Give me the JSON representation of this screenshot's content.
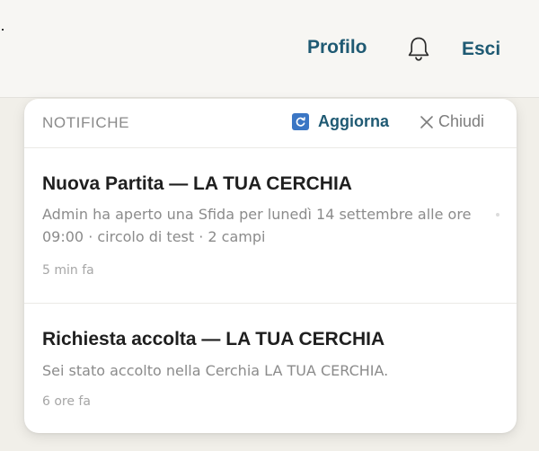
{
  "topbar": {
    "profile_label": "Profilo",
    "logout_label": "Esci",
    "link_color": "#1f5a73"
  },
  "notifications_panel": {
    "title": "NOTIFICHE",
    "refresh_label": "Aggiorna",
    "close_label": "Chiudi",
    "items": [
      {
        "title": "Nuova Partita — LA TUA CERCHIA",
        "body": "Admin ha aperto una Sfida per lunedì 14 settembre alle ore 09:00 · circolo di test · 2 campi",
        "time": "5 min fa"
      },
      {
        "title": "Richiesta accolta — LA TUA CERCHIA",
        "body": "Sei stato accolto nella Cerchia LA TUA CERCHIA.",
        "time": "6 ore fa"
      }
    ]
  },
  "icons": {
    "bell": "bell-icon",
    "refresh": "refresh-icon",
    "close": "close-icon"
  }
}
